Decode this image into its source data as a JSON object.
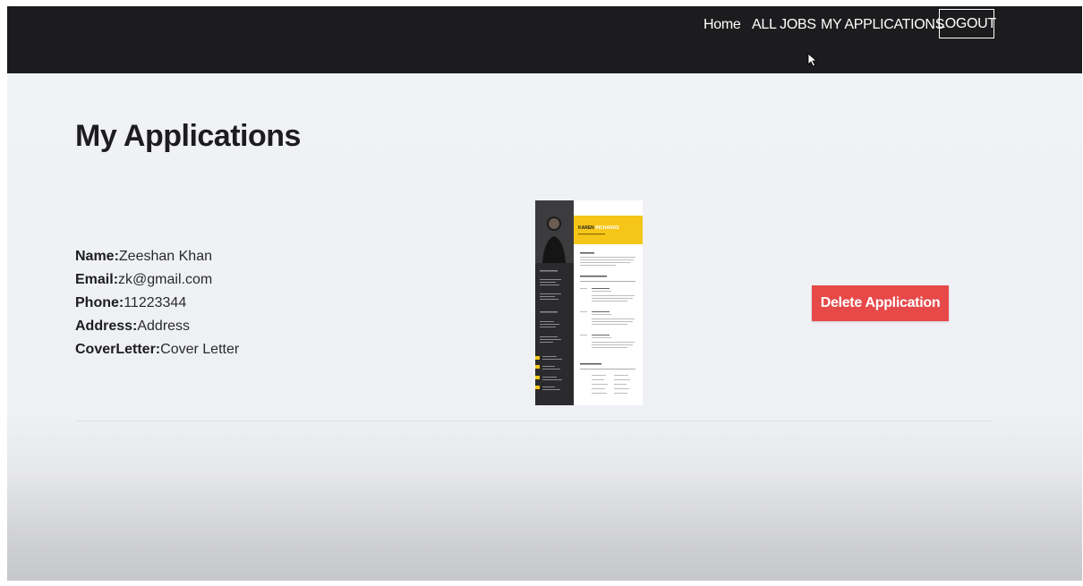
{
  "nav": {
    "home": "Home",
    "all_jobs": "ALL JOBS",
    "my_applications": "MY APPLICATIONS",
    "logout": "LOGOUT"
  },
  "page": {
    "title": "My Applications"
  },
  "application": {
    "fields": [
      {
        "label": "Name:",
        "value": "Zeeshan Khan"
      },
      {
        "label": "Email:",
        "value": "zk@gmail.com"
      },
      {
        "label": "Phone:",
        "value": "11223344"
      },
      {
        "label": "Address:",
        "value": "Address"
      },
      {
        "label": "CoverLetter:",
        "value": "Cover Letter"
      }
    ],
    "resume": {
      "name_first": "KAREN",
      "name_last": "RICHARDS"
    },
    "delete_label": "Delete Application"
  },
  "colors": {
    "navbar": "#1c1c1e",
    "delete_button": "#e74848",
    "resume_accent": "#f5c518"
  }
}
